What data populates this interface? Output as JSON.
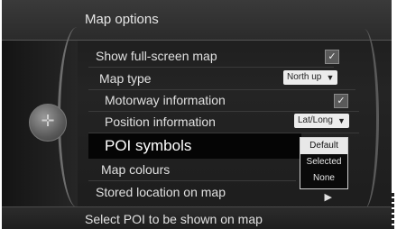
{
  "header": {
    "title": "Map options"
  },
  "knob": {
    "icon": "compass-icon"
  },
  "menu": {
    "items": [
      {
        "label": "Show full-screen map",
        "control": "checkbox",
        "checked": true
      },
      {
        "label": "Map type",
        "control": "dropdown",
        "value": "North up"
      },
      {
        "label": "Motorway information",
        "control": "checkbox",
        "checked": true
      },
      {
        "label": "Position information",
        "control": "dropdown",
        "value": "Lat/Long"
      },
      {
        "label": "POI symbols",
        "control": "popup",
        "selected": true
      },
      {
        "label": "Map colours",
        "control": "none"
      },
      {
        "label": "Stored location on map",
        "control": "submenu"
      }
    ],
    "popup_options": [
      "Default",
      "Selected",
      "None"
    ],
    "popup_selected": "Default"
  },
  "status": {
    "text": "Select POI to be shown on map"
  },
  "icons": {
    "check": "✓",
    "dropdown_arrow": "▼",
    "submenu_arrow": "▶"
  }
}
